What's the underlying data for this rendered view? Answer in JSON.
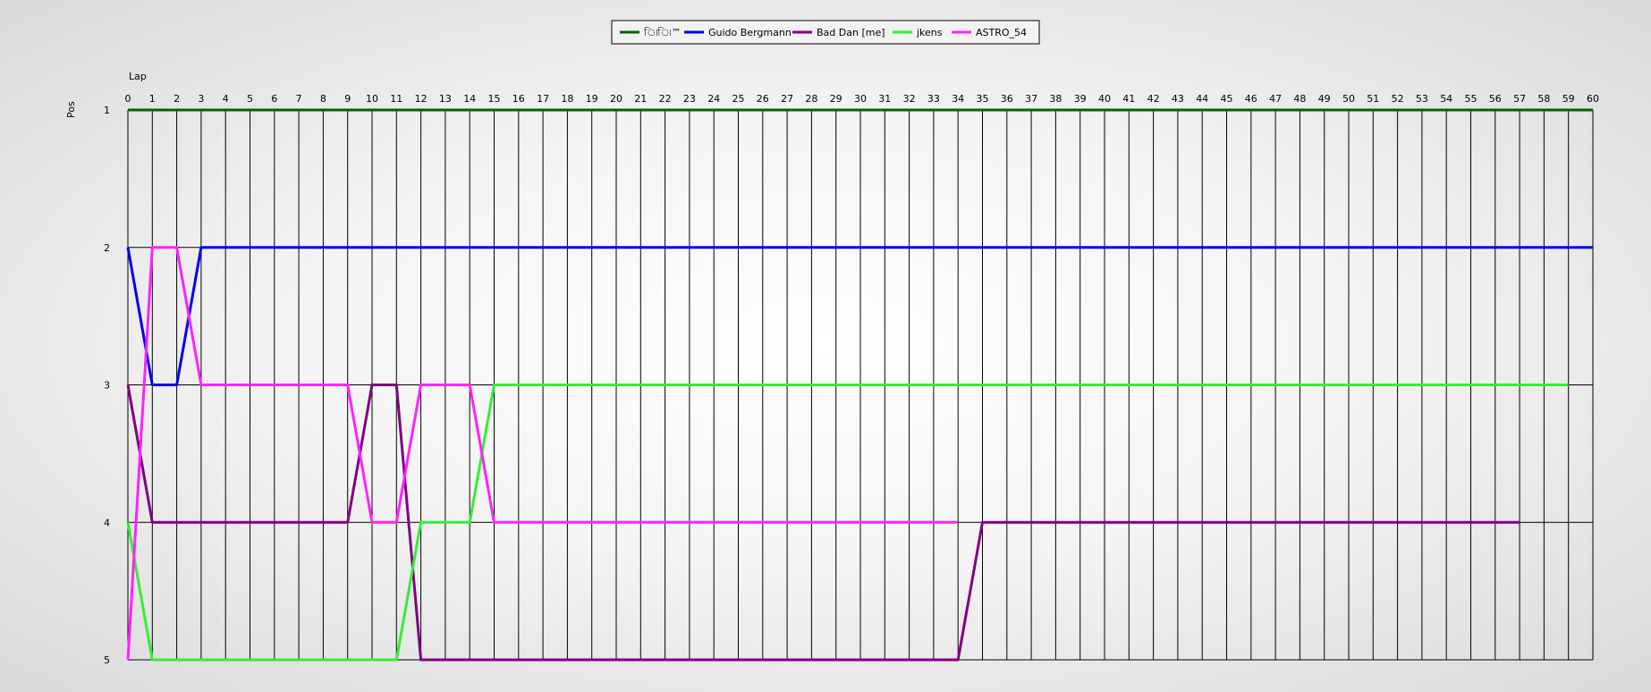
{
  "chart_data": {
    "type": "line",
    "title": "",
    "xlabel": "Lap",
    "ylabel": "Pos",
    "x_range": [
      0,
      60
    ],
    "y_range": [
      1,
      5
    ],
    "y_inverted": true,
    "grid": "vertical lines at every lap, horizontal lines at every position",
    "legend_position": "top-center",
    "x_ticks": [
      0,
      1,
      2,
      3,
      4,
      5,
      6,
      7,
      8,
      9,
      10,
      11,
      12,
      13,
      14,
      15,
      16,
      17,
      18,
      19,
      20,
      21,
      22,
      23,
      24,
      25,
      26,
      27,
      28,
      29,
      30,
      31,
      32,
      33,
      34,
      35,
      36,
      37,
      38,
      39,
      40,
      41,
      42,
      43,
      44,
      45,
      46,
      47,
      48,
      49,
      50,
      51,
      52,
      53,
      54,
      55,
      56,
      57,
      58,
      59,
      60
    ],
    "y_ticks": [
      1,
      2,
      3,
      4,
      5
    ],
    "series": [
      {
        "name": "ি৷ি৷™",
        "color": "#006400",
        "points": [
          [
            0,
            1
          ],
          [
            60,
            1
          ]
        ]
      },
      {
        "name": "Guido Bergmann",
        "color": "#0000ee",
        "points": [
          [
            0,
            2
          ],
          [
            1,
            3
          ],
          [
            2,
            3
          ],
          [
            3,
            2
          ],
          [
            60,
            2
          ]
        ]
      },
      {
        "name": "Bad Dan [me]",
        "color": "#800080",
        "points": [
          [
            0,
            3
          ],
          [
            1,
            4
          ],
          [
            9,
            4
          ],
          [
            10,
            3
          ],
          [
            11,
            3
          ],
          [
            12,
            5
          ],
          [
            34,
            5
          ],
          [
            35,
            4
          ],
          [
            57,
            4
          ]
        ]
      },
      {
        "name": "jkens",
        "color": "#33ee33",
        "points": [
          [
            0,
            4
          ],
          [
            1,
            5
          ],
          [
            11,
            5
          ],
          [
            12,
            4
          ],
          [
            14,
            4
          ],
          [
            15,
            3
          ],
          [
            59,
            3
          ]
        ]
      },
      {
        "name": "ASTRO_54",
        "color": "#ff22ff",
        "points": [
          [
            0,
            5
          ],
          [
            1,
            2
          ],
          [
            2,
            2
          ],
          [
            3,
            3
          ],
          [
            9,
            3
          ],
          [
            10,
            4
          ],
          [
            11,
            4
          ],
          [
            12,
            3
          ],
          [
            14,
            3
          ],
          [
            15,
            4
          ],
          [
            34,
            4
          ]
        ]
      }
    ]
  }
}
